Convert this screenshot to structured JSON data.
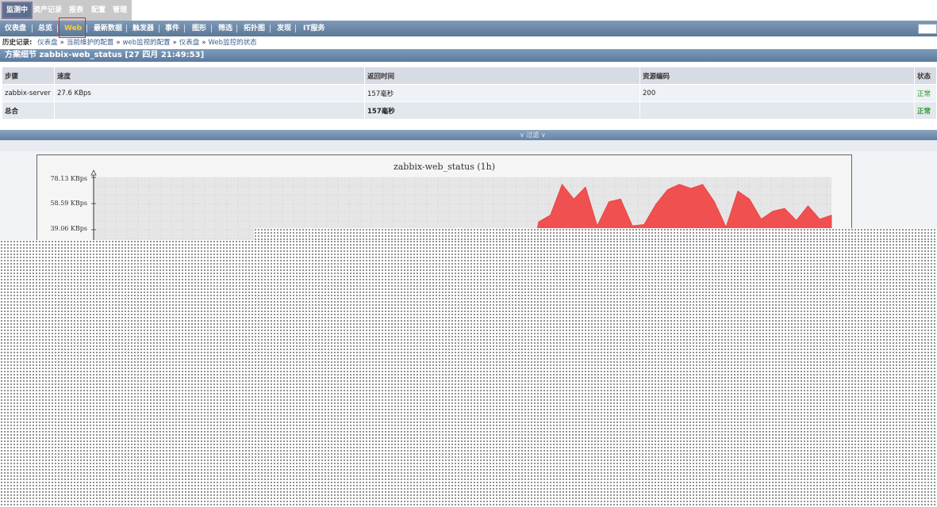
{
  "top_tabs": [
    {
      "label": "监测中",
      "active": true
    },
    {
      "label": "资产记录",
      "active": false
    },
    {
      "label": "报表",
      "active": false
    },
    {
      "label": "配置",
      "active": false
    },
    {
      "label": "管理",
      "active": false
    }
  ],
  "subnav": [
    {
      "label": "仪表盘"
    },
    {
      "label": "总览"
    },
    {
      "label": "Web",
      "active": true
    },
    {
      "label": "最新数据"
    },
    {
      "label": "触发器"
    },
    {
      "label": "事件"
    },
    {
      "label": "图形"
    },
    {
      "label": "筛选"
    },
    {
      "label": "拓扑图"
    },
    {
      "label": "发现"
    },
    {
      "label": "IT服务"
    }
  ],
  "breadcrumb": {
    "title": "历史记录:",
    "items": [
      "仪表盘",
      "当前维护的配置",
      "web监视的配置",
      "仪表盘",
      "Web监控的状态"
    ]
  },
  "page_title": "方案细节 zabbix-web_status [27 四月 21:49:53]",
  "table": {
    "headers": [
      "步骤",
      "速度",
      "返回时间",
      "资源编码",
      "状态"
    ],
    "rows": [
      [
        "zabbix-server",
        "27.6 KBps",
        "157毫秒",
        "200",
        "正常"
      ]
    ],
    "total": [
      "总合",
      "",
      "157毫秒",
      "",
      "正常"
    ]
  },
  "filter_label": "∨ 过滤 ∨",
  "chart_data": {
    "type": "area",
    "title": "zabbix-web_status (1h)",
    "y_ticks": [
      "78.13 KBps",
      "58.59 KBps",
      "39.06 KBps"
    ],
    "y_tick_values": [
      78.13,
      58.59,
      39.06
    ],
    "ylim_visible": [
      39.06,
      78.13
    ],
    "series": [
      {
        "color": "#f05050",
        "values": [
          0,
          0,
          0,
          0,
          0,
          0,
          0,
          0,
          0,
          0,
          0,
          0,
          0,
          0,
          0,
          0,
          0,
          0,
          0,
          0,
          0,
          0,
          0,
          0,
          0,
          0,
          0,
          0,
          0,
          0,
          0,
          0,
          0,
          0,
          0,
          0,
          0,
          0,
          45,
          50,
          73,
          62,
          71,
          42,
          60,
          62,
          42,
          43,
          58,
          69,
          73,
          70,
          73,
          60,
          41,
          68,
          62,
          47,
          53,
          55,
          46,
          57,
          47,
          50
        ]
      }
    ],
    "grid": true
  },
  "colors": {
    "accent": "#5b7897",
    "area_fill": "#f05050",
    "ok_status": "#2a9d2a",
    "highlight_box": "#ee2222"
  }
}
